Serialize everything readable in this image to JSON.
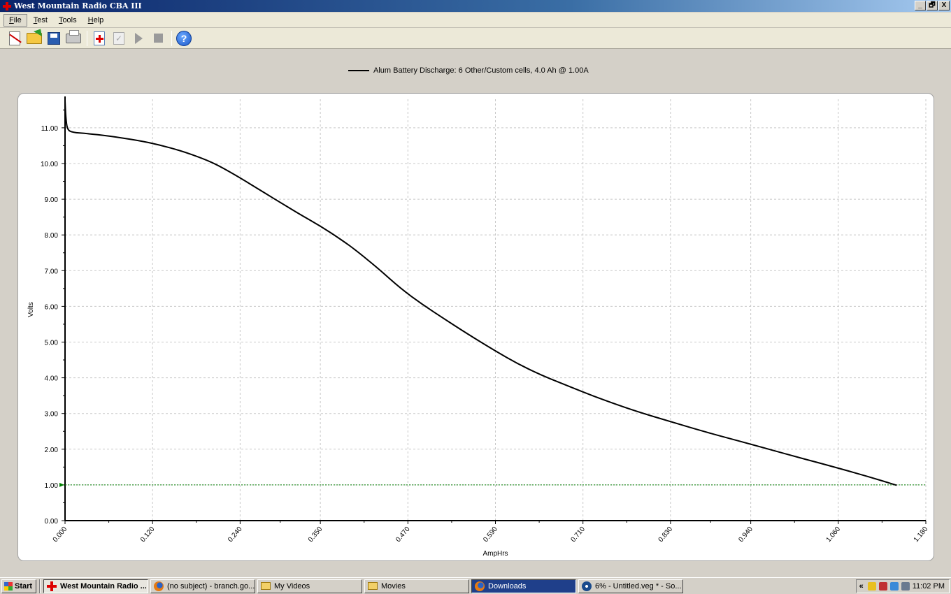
{
  "window": {
    "title": "West Mountain Radio CBA III",
    "minimize": "_",
    "restore": "🗗",
    "close": "X"
  },
  "menu": [
    {
      "label": "File",
      "key": "F",
      "rest": "ile"
    },
    {
      "label": "Test",
      "key": "T",
      "rest": "est"
    },
    {
      "label": "Tools",
      "key": "T",
      "rest": "ools"
    },
    {
      "label": "Help",
      "key": "H",
      "rest": "elp"
    }
  ],
  "toolbar": {
    "icons": [
      "new-graph-icon",
      "open-folder-icon",
      "save-disk-icon",
      "print-icon",
      "add-battery-icon",
      "check-icon",
      "play-icon",
      "stop-icon",
      "help-icon"
    ],
    "check_glyph": "✓",
    "help_glyph": "?"
  },
  "legend": {
    "label": "Alum Battery Discharge: 6 Other/Custom cells, 4.0 Ah @ 1.00A",
    "color": "#000000"
  },
  "chart_data": {
    "type": "line",
    "xlabel": "AmpHrs",
    "ylabel": "Volts",
    "xlim": [
      0.0,
      1.18
    ],
    "ylim": [
      0.0,
      11.8
    ],
    "x_ticks": [
      "0.000",
      "0.120",
      "0.240",
      "0.350",
      "0.470",
      "0.590",
      "0.710",
      "0.830",
      "0.940",
      "1.060",
      "1.180"
    ],
    "x_tick_values": [
      0.0,
      0.12,
      0.24,
      0.35,
      0.47,
      0.59,
      0.71,
      0.83,
      0.94,
      1.06,
      1.18
    ],
    "y_ticks": [
      "0.00",
      "1.00",
      "2.00",
      "3.00",
      "4.00",
      "5.00",
      "6.00",
      "7.00",
      "8.00",
      "9.00",
      "10.00",
      "11.00"
    ],
    "y_tick_values": [
      0,
      1,
      2,
      3,
      4,
      5,
      6,
      7,
      8,
      9,
      10,
      11
    ],
    "grid": true,
    "legend_position": "top-center",
    "cutoff": {
      "value": 1.0,
      "color": "#008000"
    },
    "series": [
      {
        "name": "Alum Battery Discharge: 6 Other/Custom cells, 4.0 Ah @ 1.00A",
        "color": "#000000",
        "points": [
          [
            0.0,
            11.75
          ],
          [
            0.001,
            11.3
          ],
          [
            0.003,
            10.95
          ],
          [
            0.01,
            10.87
          ],
          [
            0.03,
            10.84
          ],
          [
            0.06,
            10.77
          ],
          [
            0.1,
            10.65
          ],
          [
            0.13,
            10.52
          ],
          [
            0.16,
            10.35
          ],
          [
            0.19,
            10.13
          ],
          [
            0.21,
            9.95
          ],
          [
            0.24,
            9.6
          ],
          [
            0.27,
            9.22
          ],
          [
            0.3,
            8.85
          ],
          [
            0.32,
            8.6
          ],
          [
            0.35,
            8.25
          ],
          [
            0.38,
            7.85
          ],
          [
            0.4,
            7.55
          ],
          [
            0.43,
            7.05
          ],
          [
            0.46,
            6.5
          ],
          [
            0.49,
            6.05
          ],
          [
            0.52,
            5.65
          ],
          [
            0.55,
            5.25
          ],
          [
            0.59,
            4.75
          ],
          [
            0.62,
            4.4
          ],
          [
            0.65,
            4.1
          ],
          [
            0.68,
            3.85
          ],
          [
            0.71,
            3.6
          ],
          [
            0.74,
            3.37
          ],
          [
            0.78,
            3.08
          ],
          [
            0.83,
            2.77
          ],
          [
            0.88,
            2.47
          ],
          [
            0.94,
            2.14
          ],
          [
            1.0,
            1.8
          ],
          [
            1.06,
            1.47
          ],
          [
            1.1,
            1.24
          ],
          [
            1.14,
            0.99
          ]
        ]
      }
    ]
  },
  "taskbar": {
    "start": "Start",
    "tasks": [
      {
        "label": "West Mountain Radio ...",
        "icon": "cross",
        "state": "active",
        "width": 150
      },
      {
        "label": "(no subject) - branch.go...",
        "icon": "fox",
        "state": "normal",
        "width": 150
      },
      {
        "label": "My Videos",
        "icon": "folder",
        "state": "normal",
        "width": 150
      },
      {
        "label": "Movies",
        "icon": "folder",
        "state": "normal",
        "width": 150
      },
      {
        "label": "Downloads",
        "icon": "fox",
        "state": "dark",
        "width": 150
      },
      {
        "label": "6% - Untitled.veg * - So...",
        "icon": "sony",
        "state": "normal",
        "width": 150
      }
    ],
    "tray_chevron": "«",
    "clock": "11:02 PM"
  }
}
